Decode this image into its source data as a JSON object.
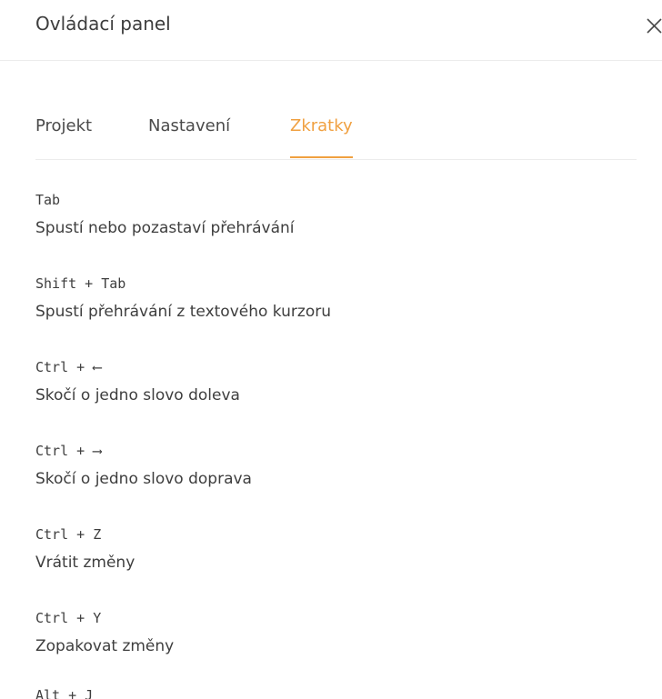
{
  "header": {
    "title": "Ovládací panel"
  },
  "tabs": [
    {
      "label": "Projekt",
      "active": false
    },
    {
      "label": "Nastavení",
      "active": false
    },
    {
      "label": "Zkratky",
      "active": true
    }
  ],
  "colors": {
    "accent": "#f0a040",
    "text": "#3e3e3e",
    "divider": "#ececec"
  },
  "shortcuts": [
    {
      "key": "Tab",
      "description": "Spustí nebo pozastaví přehrávání"
    },
    {
      "key": "Shift + Tab",
      "description": "Spustí přehrávání z textového kurzoru"
    },
    {
      "key": "Ctrl + ⟵",
      "description": "Skočí o jedno slovo doleva"
    },
    {
      "key": "Ctrl + ⟶",
      "description": "Skočí o jedno slovo doprava"
    },
    {
      "key": "Ctrl + Z",
      "description": "Vrátit změny"
    },
    {
      "key": "Ctrl + Y",
      "description": "Zopakovat změny"
    },
    {
      "key": "Alt + J",
      "description": ""
    }
  ]
}
